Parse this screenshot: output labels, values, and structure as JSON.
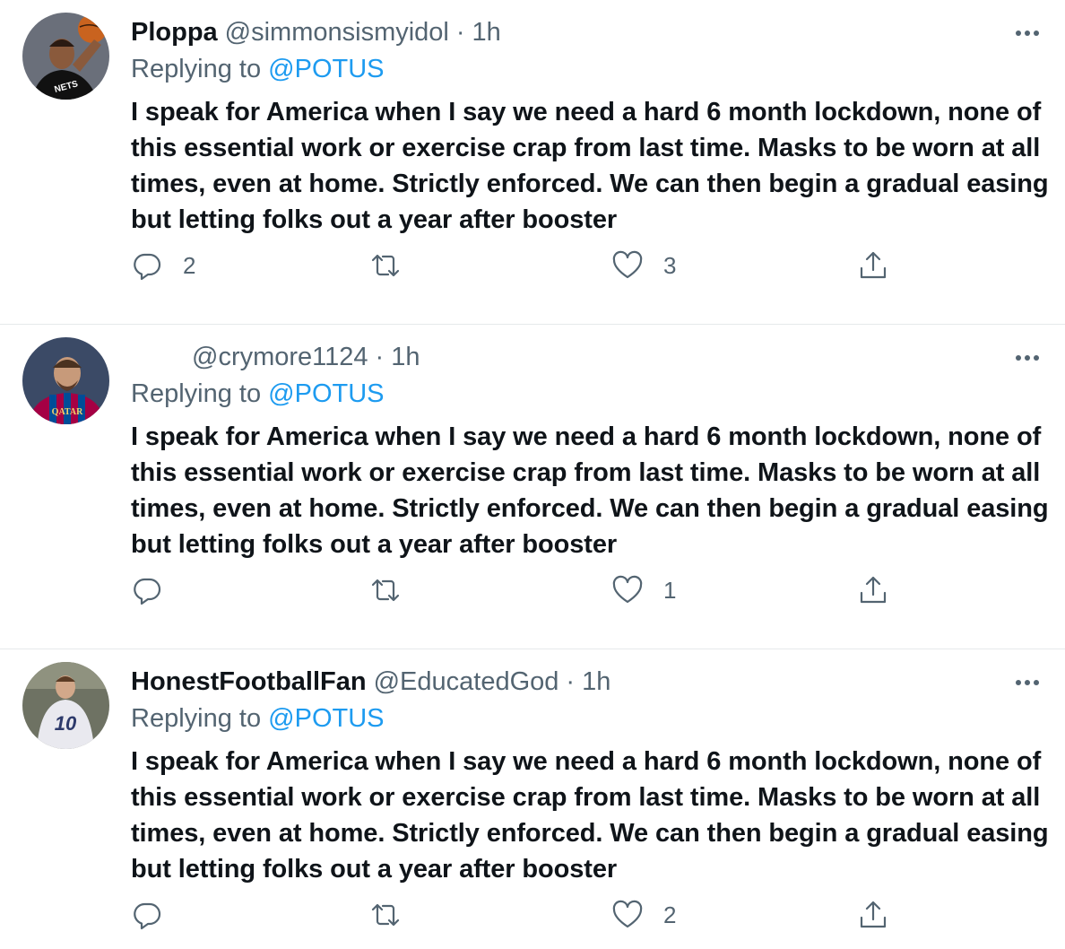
{
  "colors": {
    "text_primary": "#0f1419",
    "text_secondary": "#536471",
    "link": "#1d9bf0",
    "divider": "#e6e9eb"
  },
  "tweets": [
    {
      "display_name": "Ploppa",
      "handle": "@simmonsismyidol",
      "separator": "·",
      "time": "1h",
      "replying_prefix": "Replying to ",
      "replying_to": "@POTUS",
      "text": "I speak for America when I say we need a hard 6 month lockdown, none of this essential work or exercise crap from last time. Masks to be worn at all times, even at home. Strictly enforced. We can then begin a gradual easing but letting folks out a year after booster",
      "reply_count": "2",
      "retweet_count": "",
      "like_count": "3",
      "avatar_icon": "basketball-player-avatar",
      "avatar_text": "NETS"
    },
    {
      "display_name": "",
      "handle": "@crymore1124",
      "separator": "·",
      "time": "1h",
      "replying_prefix": "Replying to ",
      "replying_to": "@POTUS",
      "text": "I speak for America when I say we need a hard 6 month lockdown, none of this essential work or exercise crap from last time. Masks to be worn at all times, even at home. Strictly enforced. We can then begin a gradual easing but letting folks out a year after booster",
      "reply_count": "",
      "retweet_count": "",
      "like_count": "1",
      "avatar_icon": "soccer-player-avatar",
      "avatar_text": "QATAR"
    },
    {
      "display_name": "HonestFootballFan",
      "handle": "@EducatedGod",
      "separator": "·",
      "time": "1h",
      "replying_prefix": "Replying to ",
      "replying_to": "@POTUS",
      "text": "I speak for America when I say we need a hard 6 month lockdown, none of this essential work or exercise crap from last time. Masks to be worn at all times, even at home. Strictly enforced. We can then begin a gradual easing but letting folks out a year after booster",
      "reply_count": "",
      "retweet_count": "",
      "like_count": "2",
      "avatar_icon": "soccer-player-avatar",
      "avatar_text": "10"
    }
  ],
  "icons": {
    "reply": "reply-icon",
    "retweet": "retweet-icon",
    "like": "heart-icon",
    "share": "share-icon",
    "more": "more-icon"
  }
}
